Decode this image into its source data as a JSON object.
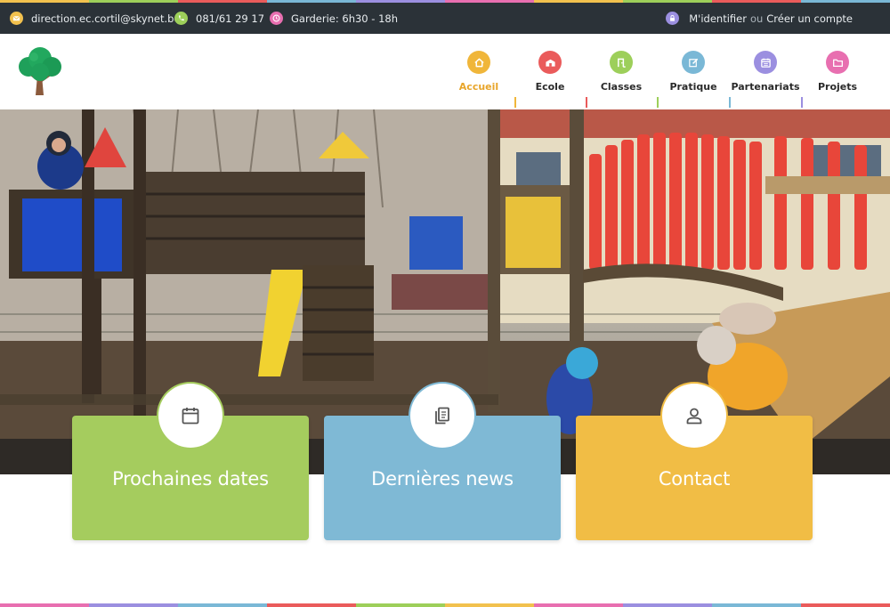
{
  "topbar": {
    "email": "direction.ec.cortil@skynet.be",
    "phone": "081/61 29 17",
    "hours": "Garderie: 6h30 - 18h",
    "login": "M'identifier",
    "or": "ou",
    "register": "Créer un compte",
    "icons": {
      "email": "envelope-icon",
      "phone": "phone-icon",
      "hours": "clock-icon",
      "login": "lock-icon"
    },
    "colors": {
      "email": "#f2c14e",
      "phone": "#9dcf5a",
      "hours": "#e86fb0",
      "login": "#9b8fe0",
      "bar": "#2b3238"
    }
  },
  "nav": {
    "items": [
      {
        "label": "Accueil",
        "icon": "home-icon",
        "color": "#f0b63a",
        "active": true
      },
      {
        "label": "Ecole",
        "icon": "school-icon",
        "color": "#ea5b5b",
        "active": false
      },
      {
        "label": "Classes",
        "icon": "door-icon",
        "color": "#9dcf5a",
        "active": false
      },
      {
        "label": "Pratique",
        "icon": "edit-icon",
        "color": "#7ab8d6",
        "active": false
      },
      {
        "label": "Partenariats",
        "icon": "calendar-icon",
        "color": "#9b8fe0",
        "active": false
      },
      {
        "label": "Projets",
        "icon": "folder-icon",
        "color": "#e86fb0",
        "active": false
      }
    ]
  },
  "cards": [
    {
      "title": "Prochaines dates",
      "icon": "calendar-icon",
      "color": "#a5cc5e"
    },
    {
      "title": "Dernières news",
      "icon": "documents-icon",
      "color": "#7fb9d5"
    },
    {
      "title": "Contact",
      "icon": "user-icon",
      "color": "#f1bd45"
    }
  ],
  "hero": {
    "image": "playground-photo"
  }
}
